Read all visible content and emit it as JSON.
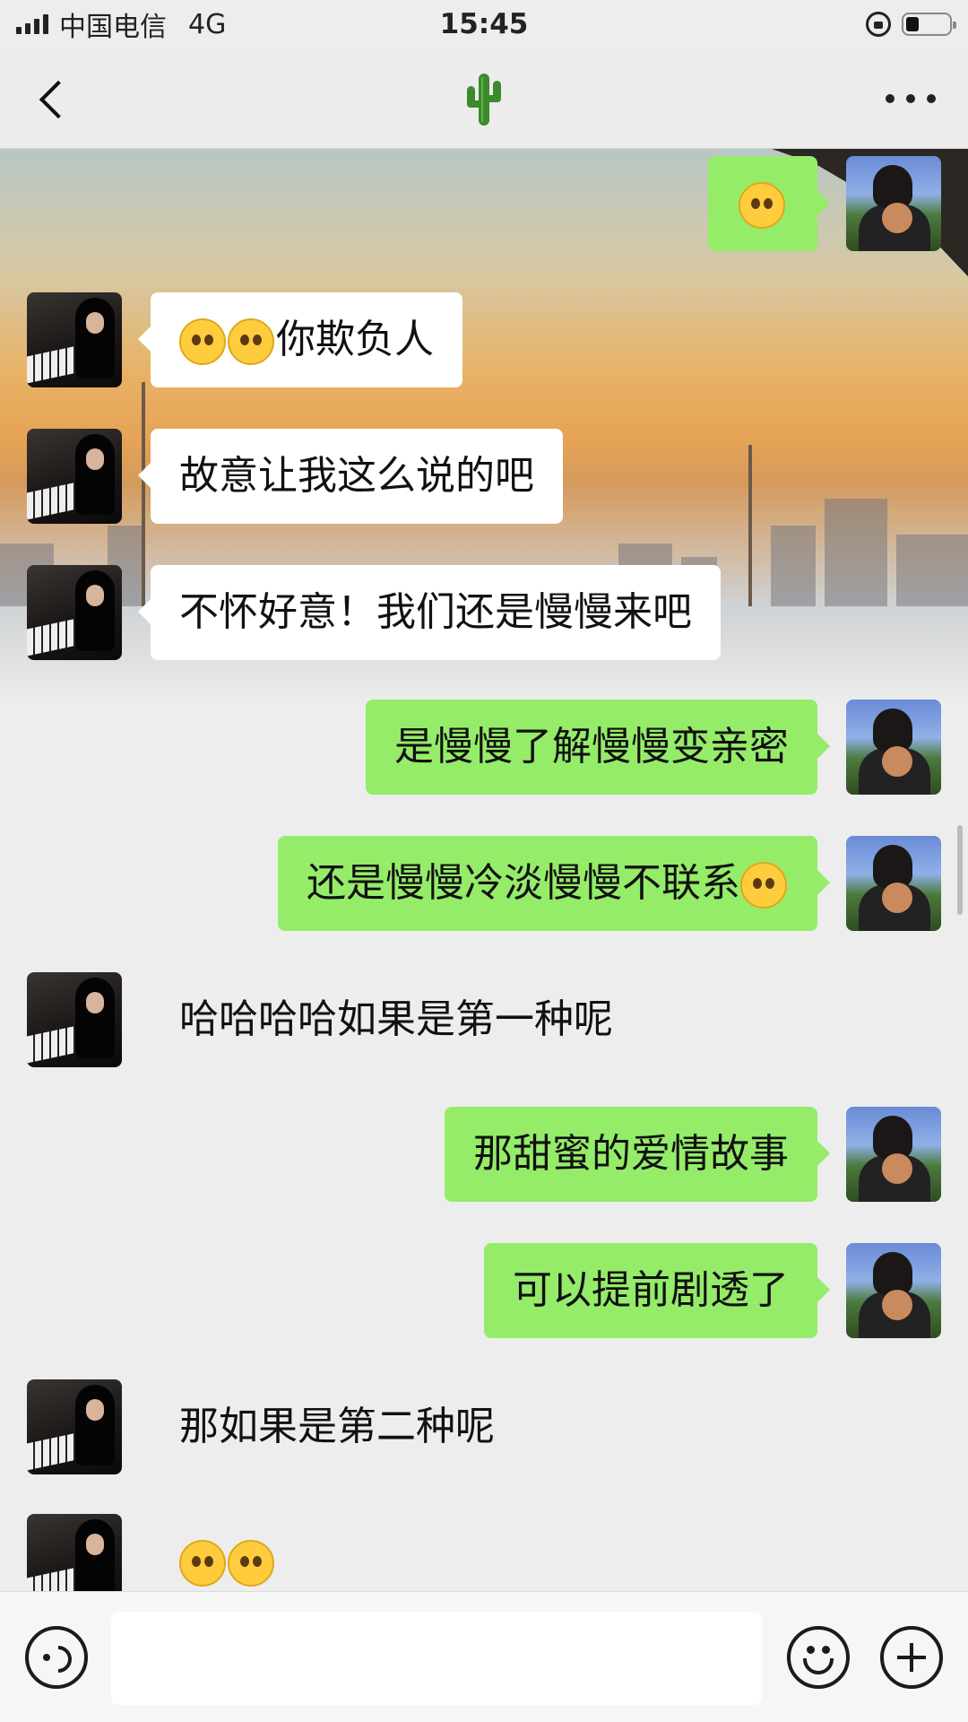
{
  "status_bar": {
    "carrier": "中国电信",
    "network": "4G",
    "time": "15:45",
    "battery_level": 0.3
  },
  "nav": {
    "title_emoji": "🌵",
    "back_icon": "chevron-left-icon",
    "more_icon": "ellipsis-icon"
  },
  "messages": [
    {
      "side": "right",
      "text": "",
      "emojis": [
        "facepalm-emoji"
      ]
    },
    {
      "side": "left",
      "text": "你欺负人",
      "emojis": [
        "crying-emoji",
        "crying-emoji"
      ]
    },
    {
      "side": "left",
      "text": "故意让我这么说的吧"
    },
    {
      "side": "left",
      "text": "不怀好意！我们还是慢慢来吧"
    },
    {
      "side": "right",
      "text": "是慢慢了解慢慢变亲密"
    },
    {
      "side": "right",
      "text": "还是慢慢冷淡慢慢不联系",
      "emojis_after": [
        "confused-emoji"
      ]
    },
    {
      "side": "left",
      "text": "哈哈哈哈如果是第一种呢"
    },
    {
      "side": "right",
      "text": "那甜蜜的爱情故事"
    },
    {
      "side": "right",
      "text": "可以提前剧透了"
    },
    {
      "side": "left",
      "text": "那如果是第二种呢"
    },
    {
      "side": "left",
      "text": "",
      "emojis": [
        "pleading-emoji",
        "pleading-emoji"
      ]
    }
  ],
  "input_bar": {
    "value": "",
    "colors": {
      "bubble_sent": "#95ec69",
      "bubble_received": "#ffffff"
    }
  }
}
